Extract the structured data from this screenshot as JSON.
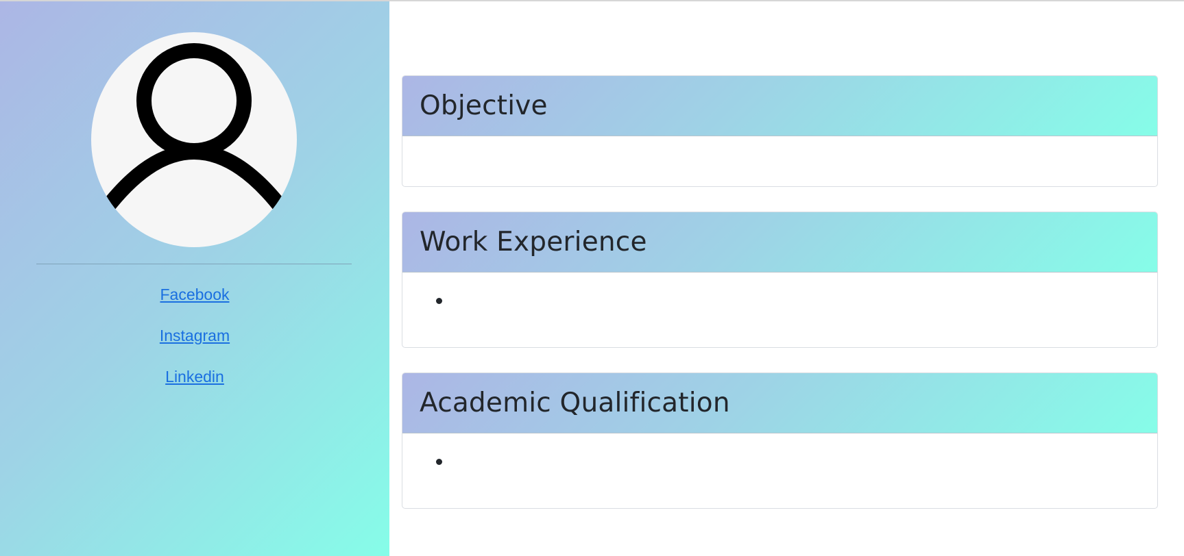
{
  "profile": {
    "avatar_icon": "user-avatar-icon"
  },
  "social": {
    "facebook_label": "Facebook",
    "instagram_label": "Instagram",
    "linkedin_label": "Linkedin"
  },
  "sections": {
    "objective": {
      "title": "Objective",
      "body": ""
    },
    "work_experience": {
      "title": "Work Experience",
      "items": [
        ""
      ]
    },
    "academic_qualification": {
      "title": "Academic Qualification",
      "items": [
        ""
      ]
    }
  },
  "colors": {
    "gradient_start": "#ACB6E5",
    "gradient_end": "#86FDE8",
    "link": "#1a6fe0",
    "heading_text": "#22262b"
  }
}
